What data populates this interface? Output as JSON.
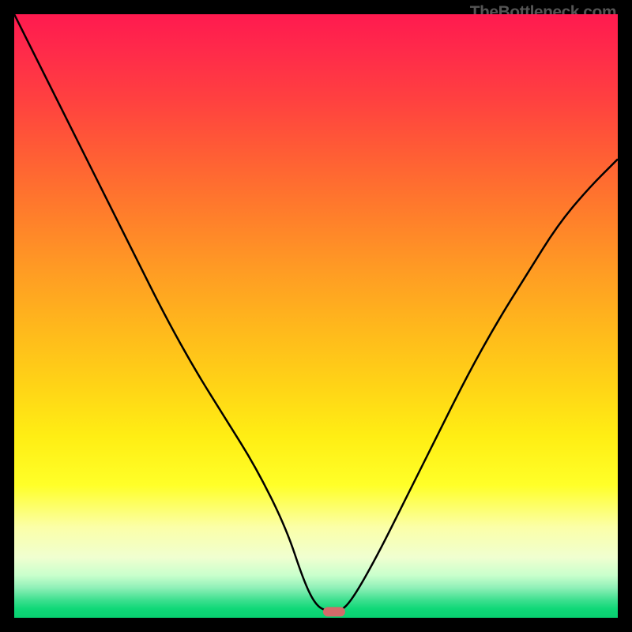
{
  "watermark": "TheBottleneck.com",
  "chart_data": {
    "type": "line",
    "title": "",
    "xlabel": "",
    "ylabel": "",
    "xlim": [
      0,
      100
    ],
    "ylim": [
      0,
      100
    ],
    "grid": false,
    "series": [
      {
        "name": "curve",
        "x": [
          0,
          5,
          10,
          15,
          20,
          25,
          30,
          35,
          40,
          45,
          48,
          50,
          52,
          54,
          56,
          60,
          65,
          70,
          75,
          80,
          85,
          90,
          95,
          100
        ],
        "values": [
          100,
          90,
          80,
          70,
          60,
          50,
          41,
          33,
          25,
          15,
          6,
          2,
          1,
          1,
          3,
          10,
          20,
          30,
          40,
          49,
          57,
          65,
          71,
          76
        ]
      }
    ],
    "annotations": [
      {
        "type": "marker",
        "x": 53,
        "y": 1,
        "shape": "pill",
        "color": "#d46a6a"
      }
    ],
    "background_gradient": {
      "direction": "vertical",
      "stops": [
        {
          "pos": 0.0,
          "color": "#ff1a4f"
        },
        {
          "pos": 0.14,
          "color": "#ff4040"
        },
        {
          "pos": 0.32,
          "color": "#ff7a2c"
        },
        {
          "pos": 0.52,
          "color": "#ffb81c"
        },
        {
          "pos": 0.7,
          "color": "#ffee14"
        },
        {
          "pos": 0.85,
          "color": "#fbffa8"
        },
        {
          "pos": 0.95,
          "color": "#90f0b8"
        },
        {
          "pos": 1.0,
          "color": "#08d070"
        }
      ]
    }
  }
}
